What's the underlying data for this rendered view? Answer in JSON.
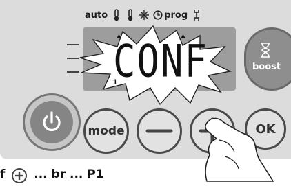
{
  "mode_bar": {
    "auto_label": "auto",
    "prog_label": "prog",
    "icons": [
      "thermometer-comfort-icon",
      "thermometer-eco-icon",
      "snowflake-icon",
      "clock-icon",
      "wrench-icon"
    ]
  },
  "display": {
    "text": "CONF",
    "sub_digit": "1"
  },
  "buttons": {
    "power_icon": "power-icon",
    "mode_label": "mode",
    "minus_icon": "minus-icon",
    "plus_icon": "plus-icon",
    "ok_label": "OK",
    "boost_label": "boost",
    "boost_icon": "hourglass-icon"
  },
  "instruction": {
    "prefix": "f",
    "suffix": "... br  ... P1"
  },
  "colors": {
    "panel": "#dcdcdc",
    "display": "#9d9d9d",
    "segment": "#111111",
    "power_button": "#858585",
    "boost_button": "#8e8e8e"
  }
}
